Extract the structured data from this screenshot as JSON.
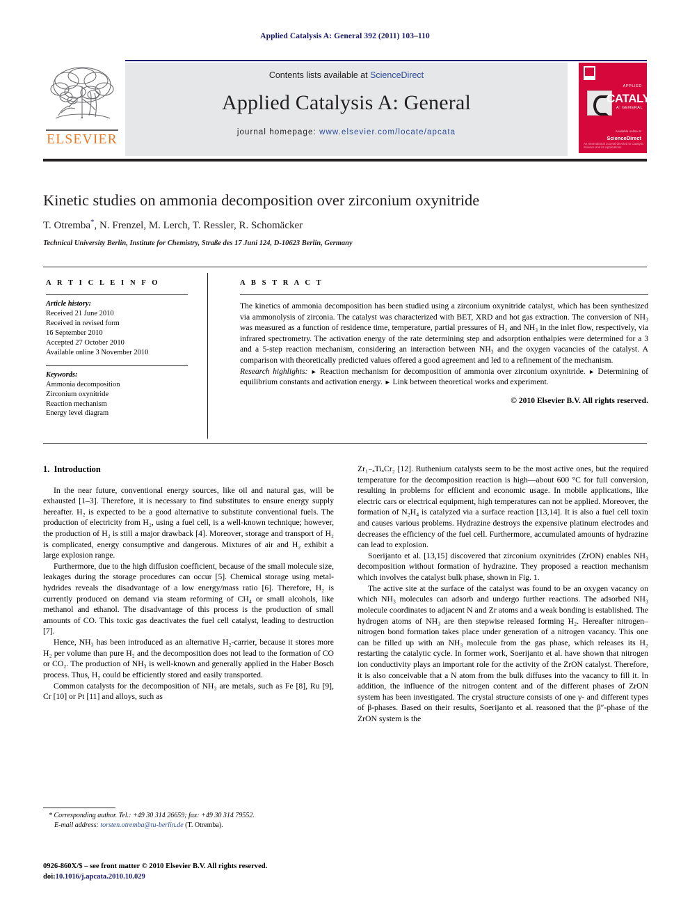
{
  "running_head": "Applied Catalysis A: General 392 (2011) 103–110",
  "masthead": {
    "contents_prefix": "Contents lists available at ",
    "contents_link": "ScienceDirect",
    "journal_name": "Applied Catalysis A: General",
    "homepage_label": "journal homepage:",
    "homepage_url": "www.elsevier.com/locate/apcata",
    "publisher_wordmark": "ELSEVIER",
    "cover": {
      "applied_label": "APPLIED",
      "title": "CATALYSIS",
      "subtitle": "A: GENERAL",
      "available_at": "Available online at",
      "sciencedirect": "ScienceDirect",
      "footer": "An International Journal devoted to Catalytic Science and its Applications"
    }
  },
  "article": {
    "title": "Kinetic studies on ammonia decomposition over zirconium oxynitride",
    "authors": "T. Otremba, N. Frenzel, M. Lerch, T. Ressler, R. Schomäcker",
    "author_star": "*",
    "affiliation": "Technical University Berlin, Institute for Chemistry, Straße des 17 Juni 124, D-10623 Berlin, Germany"
  },
  "info": {
    "heading": "A R T I C L E   I N F O",
    "history_label": "Article history:",
    "history": [
      "Received 21 June 2010",
      "Received in revised form",
      "16 September 2010",
      "Accepted 27 October 2010",
      "Available online 3 November 2010"
    ],
    "keywords_label": "Keywords:",
    "keywords": [
      "Ammonia decomposition",
      "Zirconium oxynitride",
      "Reaction mechanism",
      "Energy level diagram"
    ]
  },
  "abstract": {
    "heading": "A B S T R A C T",
    "body": "The kinetics of ammonia decomposition has been studied using a zirconium oxynitride catalyst, which has been synthesized via ammonolysis of zirconia. The catalyst was characterized with BET, XRD and hot gas extraction. The conversion of NH₃ was measured as a function of residence time, temperature, partial pressures of H₂ and NH₃ in the inlet flow, respectively, via infrared spectrometry. The activation energy of the rate determining step and adsorption enthalpies were determined for a 3 and a 5-step reaction mechanism, considering an interaction between NH₃ and the oxygen vacancies of the catalyst. A comparison with theoretically predicted values offered a good agreement and led to a refinement of the mechanism.",
    "highlights_label": "Research highlights:",
    "highlights": [
      "Reaction mechanism for decomposition of ammonia over zirconium oxynitride.",
      "Determining of equilibrium constants and activation energy.",
      "Link between theoretical works and experiment."
    ],
    "copyright": "© 2010 Elsevier B.V. All rights reserved."
  },
  "body": {
    "section_number": "1.",
    "section_title": "Introduction",
    "left_paragraphs": [
      "In the near future, conventional energy sources, like oil and natural gas, will be exhausted [1–3]. Therefore, it is necessary to find substitutes to ensure energy supply hereafter. H₂ is expected to be a good alternative to substitute conventional fuels. The production of electricity from H₂, using a fuel cell, is a well-known technique; however, the production of H₂ is still a major drawback [4]. Moreover, storage and transport of H₂ is complicated, energy consumptive and dangerous. Mixtures of air and H₂ exhibit a large explosion range.",
      "Furthermore, due to the high diffusion coefficient, because of the small molecule size, leakages during the storage procedures can occur [5]. Chemical storage using metal-hydrides reveals the disadvantage of a low energy/mass ratio [6]. Therefore, H₂ is currently produced on demand via steam reforming of CH₄ or small alcohols, like methanol and ethanol. The disadvantage of this process is the production of small amounts of CO. This toxic gas deactivates the fuel cell catalyst, leading to destruction [7].",
      "Hence, NH₃ has been introduced as an alternative H₂-carrier, because it stores more H₂ per volume than pure H₂ and the decomposition does not lead to the formation of CO or CO₂. The production of NH₃ is well-known and generally applied in the Haber Bosch process. Thus, H₂ could be efficiently stored and easily transported.",
      "Common catalysts for the decomposition of NH₃ are metals, such as Fe [8], Ru [9], Cr [10] or Pt [11] and alloys, such as"
    ],
    "right_paragraphs": [
      "Zr₁₋ₓTiₓCr₂ [12]. Ruthenium catalysts seem to be the most active ones, but the required temperature for the decomposition reaction is high—about 600 °C for full conversion, resulting in problems for efficient and economic usage. In mobile applications, like electric cars or electrical equipment, high temperatures can not be applied. Moreover, the formation of N₂H₄ is catalyzed via a surface reaction [13,14]. It is also a fuel cell toxin and causes various problems. Hydrazine destroys the expensive platinum electrodes and decreases the efficiency of the fuel cell. Furthermore, accumulated amounts of hydrazine can lead to explosion.",
      "Soerijanto et al. [13,15] discovered that zirconium oxynitrides (ZrON) enables NH₃ decomposition without formation of hydrazine. They proposed a reaction mechanism which involves the catalyst bulk phase, shown in Fig. 1.",
      "The active site at the surface of the catalyst was found to be an oxygen vacancy on which NH₃ molecules can adsorb and undergo further reactions. The adsorbed NH₃ molecule coordinates to adjacent N and Zr atoms and a weak bonding is established. The hydrogen atoms of NH₃ are then stepwise released forming H₂. Hereafter nitrogen–nitrogen bond formation takes place under generation of a nitrogen vacancy. This one can be filled up with an NH₃ molecule from the gas phase, which releases its H₂ restarting the catalytic cycle. In former work, Soerijanto et al. have shown that nitrogen ion conductivity plays an important role for the activity of the ZrON catalyst. Therefore, it is also conceivable that a N atom from the bulk diffuses into the vacancy to fill it. In addition, the influence of the nitrogen content and of the different phases of ZrON system has been investigated. The crystal structure consists of one γ- and different types of β-phases. Based on their results, Soerijanto et al. reasoned that the β″-phase of the ZrON system is the"
    ]
  },
  "footnotes": {
    "corresponding": "* Corresponding author. Tel.: +49 30 314 26659; fax: +49 30 314 79552.",
    "email_label": "E-mail address:",
    "email": "torsten.otremba@tu-berlin.de",
    "email_owner": "(T. Otremba).",
    "frontmatter": "0926-860X/$ – see front matter © 2010 Elsevier B.V. All rights reserved.",
    "doi_label": "doi:",
    "doi": "10.1016/j.apcata.2010.10.029"
  }
}
